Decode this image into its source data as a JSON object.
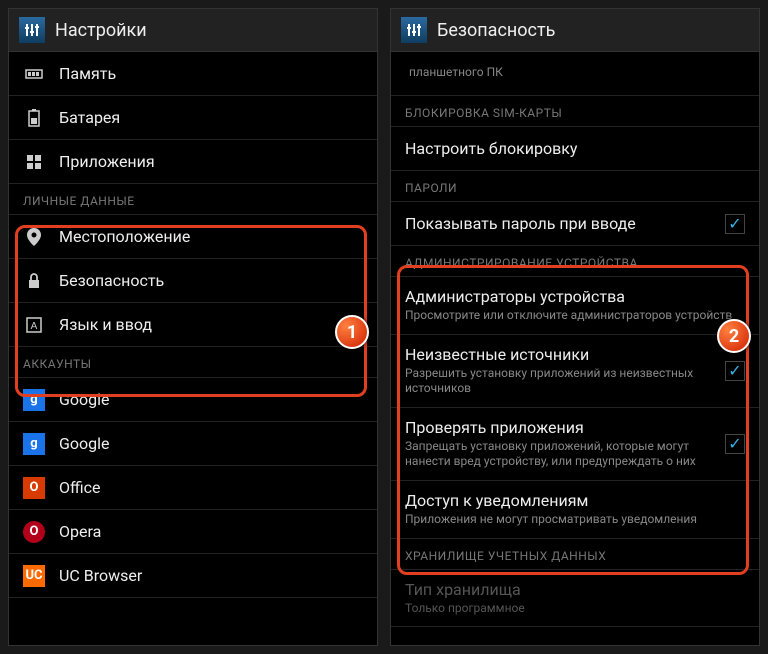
{
  "left": {
    "title": "Настройки",
    "items": [
      {
        "label": "Память"
      },
      {
        "label": "Батарея"
      },
      {
        "label": "Приложения"
      }
    ],
    "section1": "ЛИЧНЫЕ ДАННЫЕ",
    "personal": [
      {
        "label": "Местоположение"
      },
      {
        "label": "Безопасность"
      },
      {
        "label": "Язык и ввод"
      }
    ],
    "section2": "АККАУНТЫ",
    "accounts": [
      {
        "label": "Google"
      },
      {
        "label": "Google"
      },
      {
        "label": "Office"
      },
      {
        "label": "Opera"
      },
      {
        "label": "UC Browser"
      }
    ],
    "badge": "1"
  },
  "right": {
    "title": "Безопасность",
    "tablet_sub": "планшетного ПК",
    "section_sim": "БЛОКИРОВКА SIM-КАРТЫ",
    "sim_item": "Настроить блокировку",
    "section_pw": "ПАРОЛИ",
    "pw_item": "Показывать пароль при вводе",
    "section_admin": "АДМИНИСТРИРОВАНИЕ УСТРОЙСТВА",
    "admin": [
      {
        "label": "Администраторы устройства",
        "sub": "Просмотрите или отключите администраторов устройств"
      },
      {
        "label": "Неизвестные источники",
        "sub": "Разрешить установку приложений из неизвестных источников",
        "checked": true
      },
      {
        "label": "Проверять приложения",
        "sub": "Запрещать установку приложений, которые могут нанести вред устройству, или предупреждать о них",
        "checked": true
      },
      {
        "label": "Доступ к уведомлениям",
        "sub": "Приложения не могут просматривать уведомления"
      }
    ],
    "section_cred": "ХРАНИЛИЩЕ УЧЕТНЫХ ДАННЫХ",
    "cred_item": {
      "label": "Тип хранилища",
      "sub": "Только программное"
    },
    "badge": "2"
  }
}
